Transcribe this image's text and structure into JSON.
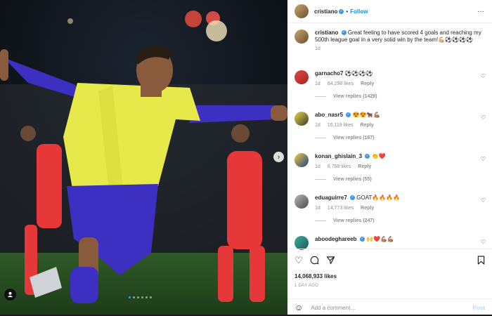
{
  "post": {
    "username": "cristiano",
    "header_sep": "•",
    "follow_label": "Follow",
    "more_icon": "…",
    "caption_text": "Great feeling to have scored 4 goals and reaching my 500th league goal in a very solid win by the team!💪🏼⚽⚽⚽⚽",
    "caption_time": "1d"
  },
  "comments": [
    {
      "username": "garnacho7",
      "verified": false,
      "text": "⚽⚽⚽⚽",
      "time": "1d",
      "likes": "84,298 likes",
      "reply": "Reply",
      "view_replies": "View replies (1429)"
    },
    {
      "username": "abo_nasr5",
      "verified": true,
      "text": "😍😍🐂💪🏽",
      "time": "1d",
      "likes": "16,119 likes",
      "reply": "Reply",
      "view_replies": "View replies (167)"
    },
    {
      "username": "konan_ghislain_3",
      "verified": true,
      "text": "👏❤️",
      "time": "1d",
      "likes": "8,768 likes",
      "reply": "Reply",
      "view_replies": "View replies (55)"
    },
    {
      "username": "eduaguirre7",
      "verified": true,
      "text": "GOAT🔥🔥🔥🔥",
      "time": "1d",
      "likes": "14,773 likes",
      "reply": "Reply",
      "view_replies": "View replies (247)"
    },
    {
      "username": "aboodeghareeb",
      "verified": true,
      "text": "🙌❤️💪🏽💪🏽",
      "time": "",
      "likes": "",
      "reply": "",
      "view_replies": ""
    }
  ],
  "stats": {
    "likes": "14,068,933 likes",
    "ago": "1 DAY AGO"
  },
  "compose": {
    "placeholder": "Add a comment…",
    "post_label": "Post"
  },
  "icons": {
    "like": "heart-icon",
    "comment": "comment-icon",
    "share": "share-icon",
    "save": "bookmark-icon",
    "emoji": "emoji-icon",
    "next": "chevron-right-icon",
    "tag": "user-tag-icon"
  },
  "carousel": {
    "slides": 6,
    "active": 0
  },
  "colors": {
    "accent": "#0095f6",
    "verified": "#3897f0",
    "jersey_yellow": "#e7e94a",
    "jersey_blue": "#3d2fc2",
    "opponent_red": "#e63838"
  }
}
